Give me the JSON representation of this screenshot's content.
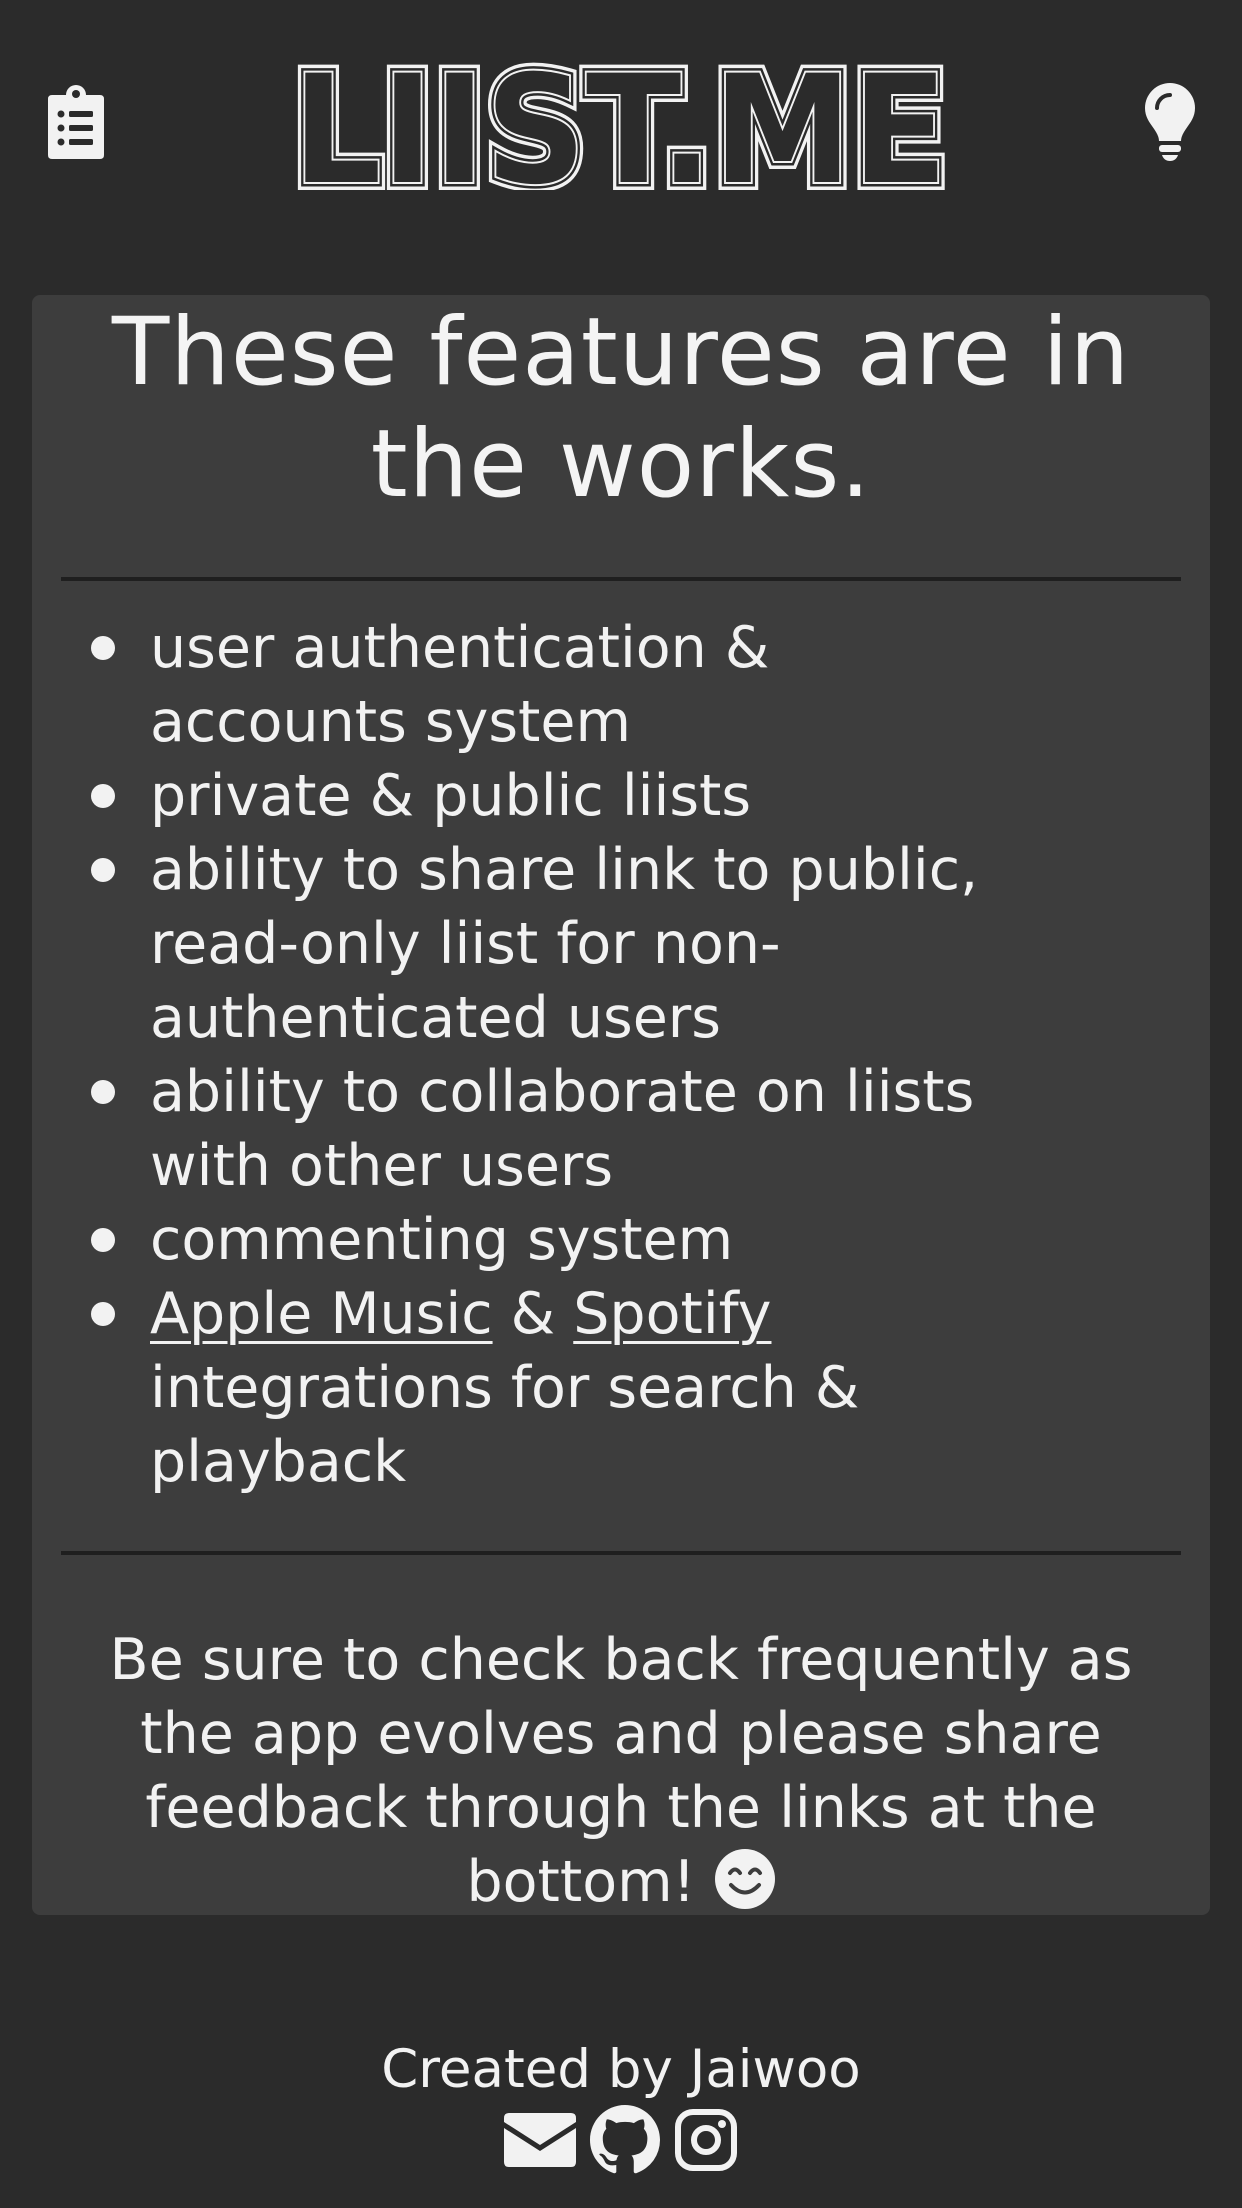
{
  "header": {
    "logo_text": "LIIST.ME",
    "left_icon": "clipboard-list-icon",
    "right_icon": "lightbulb-icon"
  },
  "card": {
    "title_line1": "These features are in",
    "title_line2": "the works.",
    "features": [
      {
        "line1": "user authentication &",
        "line2": "accounts system"
      },
      {
        "line1": "private & public liists"
      },
      {
        "line1": "ability to share link to public,",
        "line2": "read-only liist for non-",
        "line3": "authenticated users"
      },
      {
        "line1": "ability to collaborate on liists",
        "line2": "with other users"
      },
      {
        "line1": "commenting system"
      },
      {
        "link1": "Apple Music",
        "joiner": " & ",
        "link2": "Spotify",
        "line2": "integrations for search &",
        "line3": "playback"
      }
    ],
    "note_line1": "Be sure to check back frequently as",
    "note_line2": "the app evolves and please share",
    "note_line3": "feedback through the links at the",
    "note_line4": "bottom! ",
    "note_emoji": "smiling-face-icon"
  },
  "footer": {
    "credit": "Created by Jaiwoo",
    "icons": [
      "envelope-icon",
      "github-icon",
      "instagram-icon"
    ]
  },
  "colors": {
    "background": "#2b2b2b",
    "card": "#3d3d3d",
    "text": "#f2f2f2",
    "divider": "#1f1f1f"
  }
}
